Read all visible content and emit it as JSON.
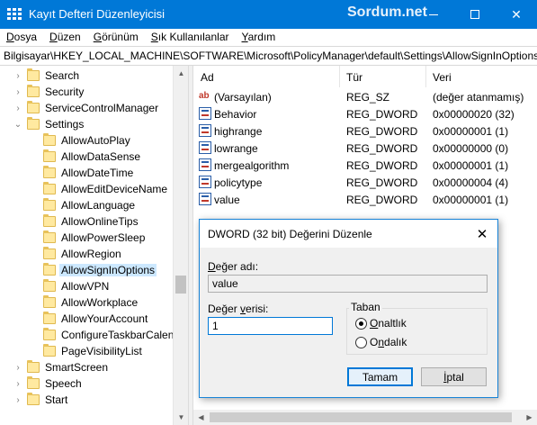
{
  "window": {
    "title": "Kayıt Defteri Düzenleyicisi",
    "watermark": "Sordum.net"
  },
  "menu": {
    "items": [
      {
        "underline": "D",
        "rest": "osya"
      },
      {
        "underline": "D",
        "rest": "üzen"
      },
      {
        "underline": "G",
        "rest": "örünüm"
      },
      {
        "underline": "S",
        "rest": "ık Kullanılanlar"
      },
      {
        "underline": "Y",
        "rest": "ardım"
      }
    ]
  },
  "address": {
    "path": "Bilgisayar\\HKEY_LOCAL_MACHINE\\SOFTWARE\\Microsoft\\PolicyManager\\default\\Settings\\AllowSignInOptions"
  },
  "tree": {
    "items": [
      {
        "label": "Search",
        "level": 1,
        "chev": "›"
      },
      {
        "label": "Security",
        "level": 1,
        "chev": "›"
      },
      {
        "label": "ServiceControlManager",
        "level": 1,
        "chev": "›"
      },
      {
        "label": "Settings",
        "level": 1,
        "chev": "⌄"
      },
      {
        "label": "AllowAutoPlay",
        "level": 2,
        "chev": ""
      },
      {
        "label": "AllowDataSense",
        "level": 2,
        "chev": ""
      },
      {
        "label": "AllowDateTime",
        "level": 2,
        "chev": ""
      },
      {
        "label": "AllowEditDeviceName",
        "level": 2,
        "chev": ""
      },
      {
        "label": "AllowLanguage",
        "level": 2,
        "chev": ""
      },
      {
        "label": "AllowOnlineTips",
        "level": 2,
        "chev": ""
      },
      {
        "label": "AllowPowerSleep",
        "level": 2,
        "chev": ""
      },
      {
        "label": "AllowRegion",
        "level": 2,
        "chev": ""
      },
      {
        "label": "AllowSignInOptions",
        "level": 2,
        "chev": "",
        "selected": true
      },
      {
        "label": "AllowVPN",
        "level": 2,
        "chev": ""
      },
      {
        "label": "AllowWorkplace",
        "level": 2,
        "chev": ""
      },
      {
        "label": "AllowYourAccount",
        "level": 2,
        "chev": ""
      },
      {
        "label": "ConfigureTaskbarCalendar",
        "level": 2,
        "chev": ""
      },
      {
        "label": "PageVisibilityList",
        "level": 2,
        "chev": ""
      },
      {
        "label": "SmartScreen",
        "level": 1,
        "chev": "›"
      },
      {
        "label": "Speech",
        "level": 1,
        "chev": "›"
      },
      {
        "label": "Start",
        "level": 1,
        "chev": "›"
      }
    ]
  },
  "list": {
    "headers": {
      "name": "Ad",
      "type": "Tür",
      "data": "Veri"
    },
    "rows": [
      {
        "icon": "string-value-icon",
        "name": "(Varsayılan)",
        "type": "REG_SZ",
        "data": "(değer atanmamış)"
      },
      {
        "icon": "dword-value-icon",
        "name": "Behavior",
        "type": "REG_DWORD",
        "data": "0x00000020 (32)"
      },
      {
        "icon": "dword-value-icon",
        "name": "highrange",
        "type": "REG_DWORD",
        "data": "0x00000001 (1)"
      },
      {
        "icon": "dword-value-icon",
        "name": "lowrange",
        "type": "REG_DWORD",
        "data": "0x00000000 (0)"
      },
      {
        "icon": "dword-value-icon",
        "name": "mergealgorithm",
        "type": "REG_DWORD",
        "data": "0x00000001 (1)"
      },
      {
        "icon": "dword-value-icon",
        "name": "policytype",
        "type": "REG_DWORD",
        "data": "0x00000004 (4)"
      },
      {
        "icon": "dword-value-icon",
        "name": "value",
        "type": "REG_DWORD",
        "data": "0x00000001 (1)"
      }
    ]
  },
  "dialog": {
    "title": "DWORD (32 bit) Değerini Düzenle",
    "name_label_u": "D",
    "name_label_rest": "eğer adı:",
    "name_value": "value",
    "data_label_pre": "Değer ",
    "data_label_u": "v",
    "data_label_rest": "erisi:",
    "data_value": "1",
    "base_label": "Taban",
    "hex_u": "O",
    "hex_rest": "naltlık",
    "dec_pre": "O",
    "dec_u": "n",
    "dec_rest": "dalık",
    "selected_base": "hex",
    "ok_label": "Tamam",
    "cancel_pre": "",
    "cancel_u": "İ",
    "cancel_rest": "ptal"
  },
  "colors": {
    "titlebar": "#0078d7",
    "selection": "#cce8ff",
    "folder": "#ffe9a0"
  }
}
